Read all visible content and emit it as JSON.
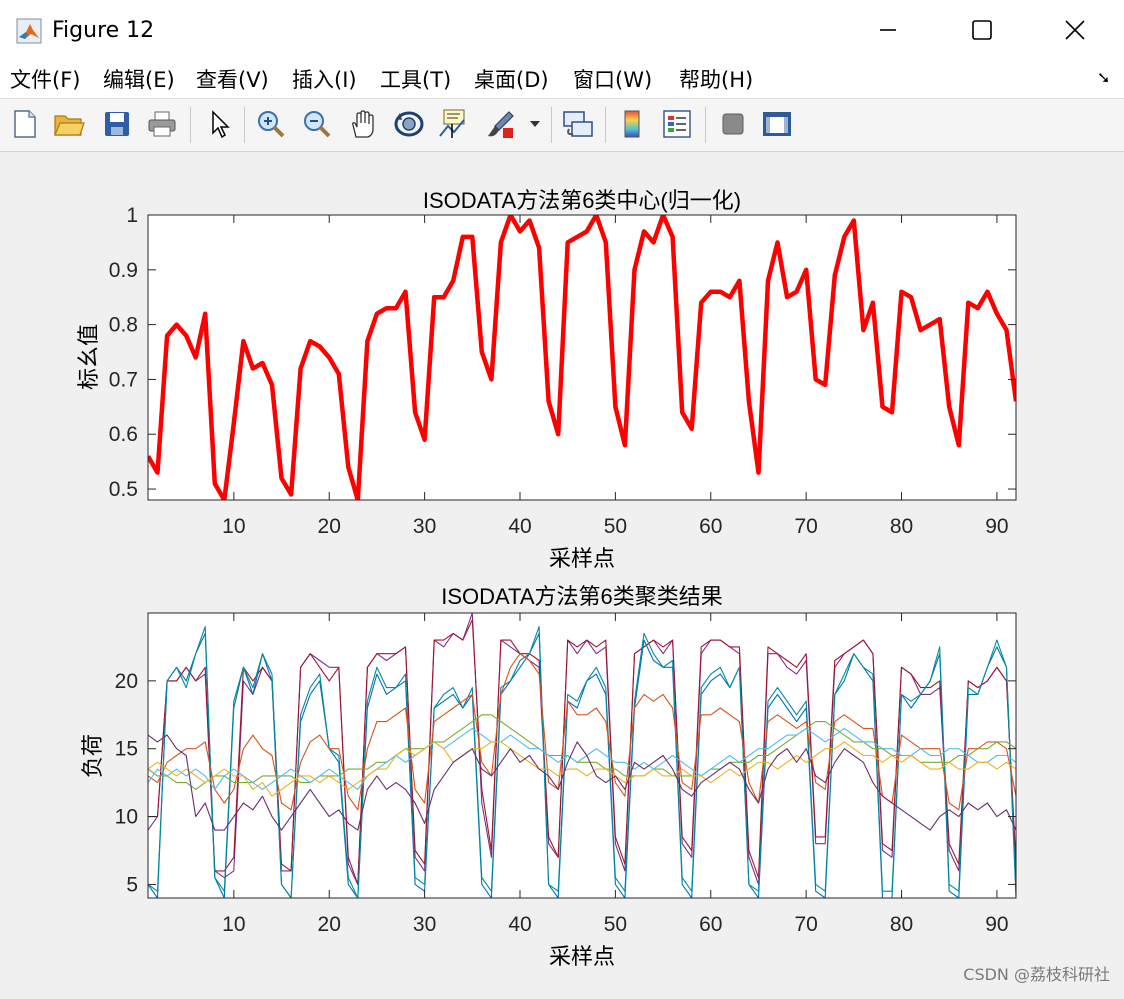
{
  "window": {
    "title": "Figure 12"
  },
  "menu": {
    "items": [
      "文件(F)",
      "编辑(E)",
      "查看(V)",
      "插入(I)",
      "工具(T)",
      "桌面(D)",
      "窗口(W)",
      "帮助(H)"
    ]
  },
  "toolbar": {
    "icons": [
      "new-figure-icon",
      "open-file-icon",
      "save-icon",
      "print-icon",
      "pointer-icon",
      "zoom-in-icon",
      "zoom-out-icon",
      "pan-hand-icon",
      "rotate-3d-icon",
      "data-cursor-icon",
      "brush-icon",
      "brush-dropdown-icon",
      "link-plot-icon",
      "colorbar-icon",
      "legend-icon",
      "hide-plot-tools-icon",
      "show-plot-tools-icon"
    ]
  },
  "watermark": "CSDN @荔枝科研社",
  "chart_data": [
    {
      "type": "line",
      "title": "ISODATA方法第6类中心(归一化)",
      "xlabel": "采样点",
      "ylabel": "标幺值",
      "xlim": [
        1,
        92
      ],
      "ylim": [
        0.48,
        1.0
      ],
      "xticks": [
        10,
        20,
        30,
        40,
        50,
        60,
        70,
        80,
        90
      ],
      "yticks": [
        0.5,
        0.6,
        0.7,
        0.8,
        0.9,
        1
      ],
      "ytick_labels": [
        "0.5",
        "0.6",
        "0.7",
        "0.8",
        "0.9",
        "1"
      ],
      "grid": false,
      "series": [
        {
          "color": "#ff0000",
          "values": [
            0.56,
            0.53,
            0.78,
            0.8,
            0.78,
            0.74,
            0.82,
            0.51,
            0.48,
            0.62,
            0.77,
            0.72,
            0.73,
            0.69,
            0.52,
            0.49,
            0.72,
            0.77,
            0.76,
            0.74,
            0.71,
            0.54,
            0.48,
            0.77,
            0.82,
            0.83,
            0.83,
            0.86,
            0.64,
            0.59,
            0.85,
            0.85,
            0.88,
            0.96,
            0.96,
            0.75,
            0.7,
            0.95,
            1.0,
            0.97,
            0.99,
            0.94,
            0.66,
            0.6,
            0.95,
            0.96,
            0.97,
            1.0,
            0.95,
            0.65,
            0.58,
            0.9,
            0.97,
            0.95,
            1.0,
            0.96,
            0.64,
            0.61,
            0.84,
            0.86,
            0.86,
            0.85,
            0.88,
            0.66,
            0.53,
            0.88,
            0.95,
            0.85,
            0.86,
            0.9,
            0.7,
            0.69,
            0.89,
            0.96,
            0.99,
            0.79,
            0.84,
            0.65,
            0.64,
            0.86,
            0.85,
            0.79,
            0.8,
            0.81,
            0.65,
            0.58,
            0.84,
            0.83,
            0.86,
            0.82,
            0.79,
            0.66
          ]
        }
      ]
    },
    {
      "type": "line",
      "title": "ISODATA方法第6类聚类结果",
      "xlabel": "采样点",
      "ylabel": "负荷",
      "xlim": [
        1,
        92
      ],
      "ylim": [
        4,
        25
      ],
      "xticks": [
        10,
        20,
        30,
        40,
        50,
        60,
        70,
        80,
        90
      ],
      "yticks": [
        5,
        10,
        15,
        20
      ],
      "ytick_labels": [
        "5",
        "10",
        "15",
        "20"
      ],
      "grid": false,
      "series": [
        {
          "color": "#7e2f8e",
          "values": [
            9.0,
            10.0,
            20.0,
            20.0,
            21.0,
            20.0,
            20.5,
            6.0,
            5.5,
            6.0,
            20.0,
            19.0,
            21.0,
            20.0,
            6.0,
            6.0,
            21.0,
            22.0,
            21.5,
            21.0,
            21.0,
            6.5,
            5.0,
            21.0,
            22.0,
            21.5,
            22.0,
            22.5,
            7.0,
            6.0,
            23.0,
            22.5,
            23.5,
            23.0,
            25.0,
            11.0,
            7.0,
            23.0,
            22.5,
            22.0,
            21.5,
            21.0,
            8.0,
            7.0,
            23.0,
            22.0,
            23.0,
            22.0,
            22.5,
            8.0,
            6.0,
            22.0,
            22.5,
            23.0,
            22.0,
            23.0,
            8.0,
            7.0,
            22.0,
            23.0,
            23.0,
            22.5,
            22.0,
            7.0,
            5.0,
            22.0,
            22.0,
            21.0,
            20.5,
            21.5,
            8.0,
            8.0,
            21.0,
            22.0,
            22.5,
            23.0,
            22.0,
            7.5,
            7.0,
            21.0,
            20.5,
            19.0,
            19.0,
            19.5,
            7.5,
            6.0,
            20.0,
            19.5,
            20.0,
            21.0,
            20.0,
            6.0
          ]
        },
        {
          "color": "#a2142f",
          "values": [
            10.0,
            10.0,
            20.0,
            20.0,
            21.0,
            20.0,
            21.0,
            6.0,
            6.0,
            7.0,
            21.0,
            20.0,
            21.0,
            20.0,
            6.5,
            6.0,
            21.0,
            22.0,
            21.0,
            20.0,
            21.0,
            7.0,
            5.0,
            21.0,
            22.0,
            22.0,
            22.0,
            22.5,
            7.5,
            6.5,
            23.0,
            23.0,
            23.5,
            23.0,
            24.5,
            12.0,
            7.5,
            23.0,
            23.0,
            22.0,
            22.0,
            21.5,
            8.5,
            7.0,
            23.0,
            22.5,
            23.0,
            22.5,
            23.0,
            8.5,
            6.5,
            22.0,
            22.5,
            23.0,
            22.5,
            23.0,
            8.5,
            7.5,
            22.5,
            23.0,
            23.0,
            22.5,
            22.5,
            7.5,
            5.5,
            22.5,
            22.0,
            21.5,
            21.0,
            22.0,
            8.5,
            8.5,
            21.5,
            22.0,
            22.5,
            23.0,
            22.0,
            8.0,
            7.5,
            21.0,
            20.5,
            19.5,
            19.5,
            20.0,
            8.0,
            6.5,
            20.0,
            19.5,
            20.0,
            21.0,
            20.0,
            6.5
          ]
        },
        {
          "color": "#0072bd",
          "values": [
            5.0,
            4.0,
            20.0,
            21.0,
            20.0,
            22.0,
            23.5,
            5.5,
            4.0,
            18.0,
            21.0,
            19.0,
            22.0,
            20.0,
            5.0,
            4.0,
            17.0,
            19.0,
            20.0,
            15.0,
            14.0,
            5.0,
            4.0,
            18.0,
            20.5,
            19.0,
            19.5,
            20.0,
            5.0,
            4.5,
            18.0,
            18.5,
            19.0,
            18.0,
            19.0,
            5.0,
            4.0,
            19.0,
            20.0,
            21.0,
            22.0,
            23.5,
            5.0,
            4.0,
            18.5,
            18.0,
            20.0,
            20.5,
            19.0,
            5.0,
            4.0,
            18.0,
            23.0,
            21.5,
            21.0,
            21.0,
            5.0,
            4.0,
            19.0,
            20.0,
            20.5,
            19.5,
            21.0,
            5.0,
            4.0,
            18.0,
            19.0,
            18.0,
            17.0,
            18.0,
            4.5,
            4.0,
            19.0,
            20.0,
            22.0,
            21.0,
            20.0,
            4.0,
            4.0,
            19.0,
            18.0,
            19.0,
            20.0,
            22.0,
            4.5,
            4.0,
            19.0,
            19.0,
            21.0,
            22.5,
            21.0,
            4.0
          ]
        },
        {
          "color": "#008b9b",
          "values": [
            5.0,
            4.5,
            20.0,
            21.0,
            19.5,
            22.0,
            24.0,
            5.5,
            4.5,
            18.5,
            21.0,
            19.5,
            22.0,
            20.5,
            5.0,
            4.0,
            17.5,
            19.5,
            20.5,
            15.0,
            14.5,
            5.5,
            4.0,
            18.5,
            21.0,
            19.5,
            19.5,
            20.5,
            5.5,
            5.0,
            18.0,
            19.0,
            19.5,
            18.0,
            19.5,
            5.5,
            4.5,
            19.5,
            20.0,
            21.5,
            22.0,
            24.0,
            5.0,
            4.5,
            19.0,
            18.5,
            20.0,
            21.0,
            19.5,
            5.5,
            4.5,
            18.5,
            23.5,
            22.0,
            21.0,
            21.5,
            5.5,
            4.5,
            19.5,
            20.5,
            21.0,
            19.5,
            21.0,
            5.0,
            4.5,
            18.5,
            19.5,
            18.5,
            17.5,
            18.5,
            5.0,
            4.5,
            19.0,
            20.5,
            22.0,
            21.0,
            20.5,
            4.5,
            4.5,
            19.0,
            18.5,
            19.0,
            20.0,
            22.5,
            5.0,
            4.5,
            19.5,
            19.0,
            21.0,
            23.0,
            21.0,
            4.5
          ]
        },
        {
          "color": "#d95319",
          "values": [
            13.0,
            12.5,
            14.0,
            14.5,
            15.0,
            15.0,
            15.5,
            12.0,
            11.0,
            12.0,
            15.0,
            16.0,
            15.0,
            14.5,
            11.0,
            10.5,
            14.0,
            15.5,
            16.0,
            15.0,
            15.0,
            11.5,
            10.5,
            15.0,
            17.0,
            17.0,
            17.5,
            18.0,
            12.0,
            11.0,
            17.0,
            17.5,
            18.0,
            18.5,
            19.0,
            14.0,
            13.0,
            19.0,
            21.0,
            22.0,
            21.5,
            20.5,
            12.5,
            12.0,
            18.5,
            17.5,
            17.5,
            18.0,
            17.0,
            12.5,
            11.5,
            18.0,
            19.0,
            18.5,
            19.0,
            18.0,
            12.5,
            12.0,
            17.5,
            17.5,
            18.0,
            17.5,
            17.0,
            12.5,
            11.0,
            17.0,
            17.5,
            17.0,
            16.5,
            17.0,
            12.5,
            12.0,
            17.0,
            17.5,
            17.0,
            16.5,
            16.5,
            11.5,
            11.0,
            16.0,
            15.5,
            15.0,
            15.0,
            15.0,
            11.0,
            10.5,
            15.0,
            15.0,
            15.5,
            15.5,
            15.0,
            11.5
          ]
        },
        {
          "color": "#77ac30",
          "values": [
            13.5,
            13.0,
            13.0,
            12.5,
            12.5,
            12.0,
            12.5,
            13.0,
            13.0,
            12.5,
            12.5,
            12.5,
            13.0,
            13.0,
            13.0,
            13.0,
            12.5,
            12.5,
            13.0,
            13.0,
            13.0,
            13.5,
            13.5,
            13.5,
            14.0,
            14.0,
            14.5,
            15.0,
            15.0,
            15.0,
            15.5,
            15.5,
            16.0,
            16.5,
            17.0,
            17.5,
            17.5,
            17.0,
            16.5,
            16.0,
            15.5,
            15.0,
            14.5,
            14.5,
            14.5,
            14.0,
            14.0,
            14.0,
            13.5,
            13.5,
            13.0,
            13.0,
            13.0,
            13.5,
            13.5,
            13.0,
            13.0,
            13.0,
            13.0,
            13.5,
            13.5,
            14.0,
            14.0,
            14.0,
            14.5,
            14.5,
            15.0,
            15.5,
            16.0,
            16.5,
            17.0,
            17.0,
            16.5,
            16.0,
            15.5,
            15.5,
            15.0,
            15.0,
            14.5,
            14.5,
            14.5,
            14.0,
            14.0,
            14.0,
            14.0,
            14.5,
            14.5,
            15.0,
            15.0,
            15.5,
            15.5,
            15.0
          ]
        },
        {
          "color": "#4dbeee",
          "values": [
            12.5,
            13.5,
            13.0,
            13.5,
            13.0,
            13.5,
            13.0,
            12.0,
            13.0,
            13.5,
            13.0,
            12.5,
            12.0,
            12.5,
            13.0,
            13.5,
            13.0,
            12.5,
            13.0,
            13.5,
            13.0,
            12.5,
            12.0,
            13.0,
            13.5,
            14.0,
            14.5,
            14.0,
            14.5,
            15.0,
            15.5,
            15.0,
            15.5,
            16.0,
            16.5,
            16.0,
            15.5,
            15.5,
            16.0,
            15.5,
            15.0,
            15.0,
            14.5,
            14.0,
            14.5,
            14.0,
            14.5,
            15.0,
            14.5,
            14.0,
            14.0,
            13.5,
            14.0,
            13.5,
            14.0,
            14.5,
            14.0,
            13.5,
            13.0,
            13.5,
            14.0,
            14.5,
            14.0,
            14.5,
            15.0,
            15.0,
            15.5,
            16.0,
            16.0,
            16.5,
            16.0,
            15.5,
            16.0,
            16.5,
            16.0,
            15.5,
            15.5,
            15.0,
            15.0,
            14.5,
            14.5,
            15.0,
            14.5,
            14.5,
            15.0,
            15.0,
            14.5,
            14.0,
            14.0,
            14.5,
            14.5,
            14.0
          ]
        },
        {
          "color": "#edb120",
          "values": [
            13.5,
            14.0,
            13.5,
            13.0,
            13.5,
            13.0,
            12.5,
            13.0,
            13.5,
            13.0,
            13.0,
            12.0,
            12.5,
            11.5,
            12.0,
            12.5,
            13.0,
            13.0,
            12.5,
            13.0,
            12.5,
            12.0,
            12.5,
            13.0,
            13.5,
            13.5,
            14.5,
            15.0,
            14.5,
            15.0,
            15.5,
            15.0,
            14.0,
            14.5,
            15.0,
            15.0,
            15.5,
            15.5,
            15.0,
            14.5,
            14.0,
            13.5,
            13.5,
            13.0,
            13.5,
            13.5,
            13.0,
            13.5,
            13.5,
            13.0,
            12.5,
            13.0,
            13.0,
            13.5,
            13.0,
            13.0,
            13.5,
            13.0,
            13.0,
            12.5,
            13.0,
            13.5,
            13.0,
            13.5,
            14.0,
            14.0,
            13.5,
            14.0,
            14.5,
            14.0,
            14.5,
            15.0,
            15.0,
            15.5,
            15.0,
            14.5,
            14.5,
            14.0,
            14.5,
            14.0,
            14.5,
            14.0,
            13.5,
            13.5,
            14.0,
            13.5,
            13.5,
            14.0,
            14.0,
            13.5,
            14.0,
            13.5
          ]
        },
        {
          "color": "#6b2c70",
          "values": [
            16.0,
            15.5,
            16.0,
            15.0,
            14.5,
            10.0,
            11.0,
            9.0,
            9.0,
            10.0,
            11.0,
            10.5,
            11.5,
            10.0,
            9.0,
            10.0,
            11.0,
            12.0,
            11.0,
            10.0,
            10.5,
            9.5,
            9.0,
            12.0,
            13.0,
            12.0,
            12.5,
            12.0,
            11.0,
            9.5,
            12.0,
            13.0,
            14.0,
            14.5,
            15.0,
            13.5,
            13.0,
            14.0,
            15.0,
            14.0,
            14.5,
            13.5,
            13.0,
            12.0,
            14.0,
            15.5,
            14.5,
            13.0,
            12.5,
            13.0,
            12.0,
            14.0,
            13.5,
            14.0,
            14.5,
            13.5,
            12.0,
            11.5,
            12.5,
            13.0,
            13.5,
            14.0,
            13.5,
            12.0,
            11.0,
            13.5,
            14.5,
            15.0,
            14.0,
            15.0,
            13.0,
            12.5,
            14.0,
            15.0,
            14.5,
            14.0,
            12.5,
            11.5,
            11.0,
            10.5,
            10.0,
            9.5,
            9.0,
            10.0,
            10.5,
            10.0,
            11.0,
            10.5,
            11.0,
            10.0,
            10.5,
            9.0
          ]
        }
      ]
    }
  ]
}
